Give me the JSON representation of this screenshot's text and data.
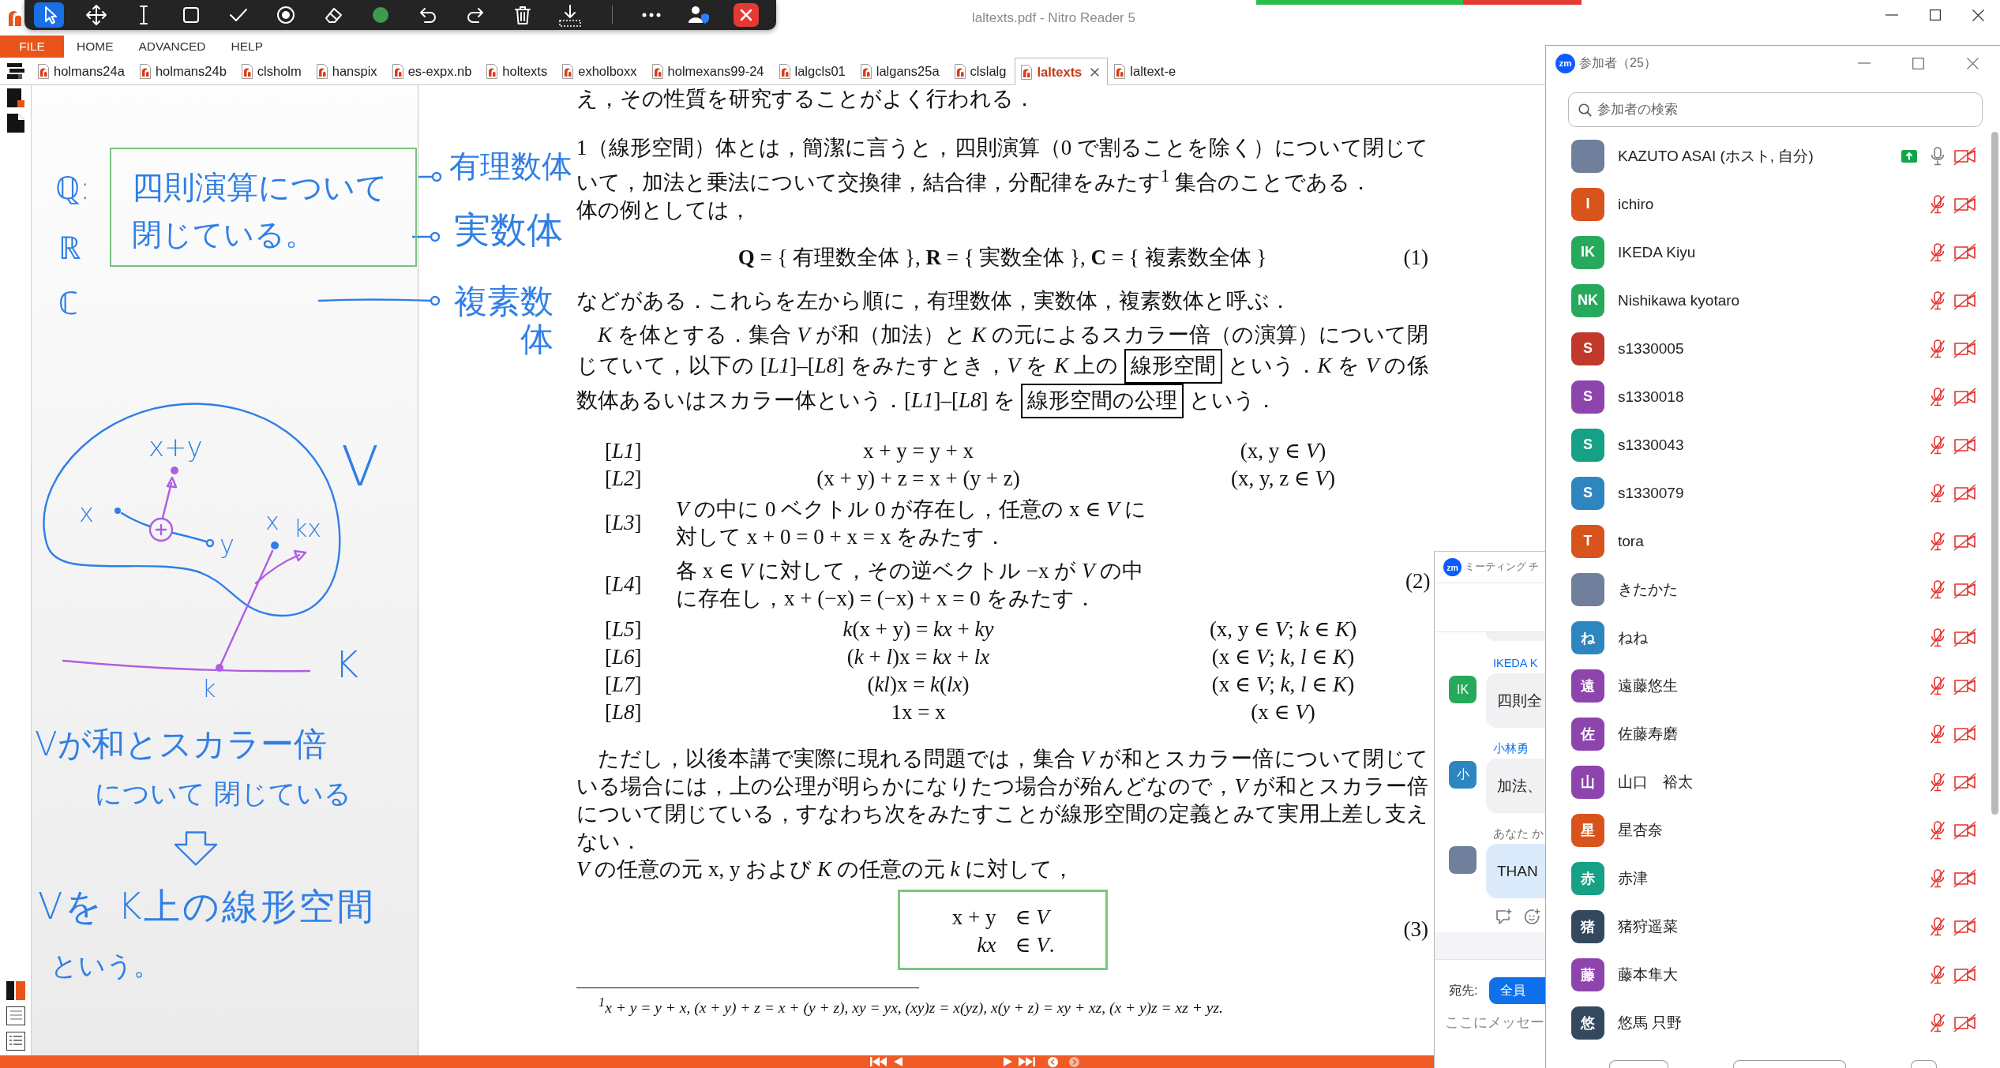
{
  "window": {
    "title": "laltexts.pdf - Nitro Reader 5"
  },
  "annotation_toolbar": {
    "tools": [
      {
        "kind": "pointer",
        "selected": true
      },
      {
        "kind": "move",
        "selected": false
      },
      {
        "kind": "text",
        "selected": false
      },
      {
        "kind": "rectangle",
        "selected": false
      },
      {
        "kind": "check",
        "selected": false
      },
      {
        "kind": "spotlight",
        "selected": false
      },
      {
        "kind": "eraser",
        "selected": false
      },
      {
        "kind": "color",
        "selected": false,
        "color": "#3e9a4c"
      },
      {
        "kind": "undo",
        "selected": false
      },
      {
        "kind": "redo",
        "selected": false
      },
      {
        "kind": "delete",
        "selected": false
      },
      {
        "kind": "save",
        "selected": false
      }
    ],
    "actions": [
      {
        "kind": "more"
      },
      {
        "kind": "people"
      },
      {
        "kind": "close"
      }
    ]
  },
  "menu": [
    {
      "label": "FILE",
      "kind": "file"
    },
    {
      "label": "HOME",
      "kind": "menu"
    },
    {
      "label": "ADVANCED",
      "kind": "menu"
    },
    {
      "label": "HELP",
      "kind": "menu"
    }
  ],
  "tabs": [
    {
      "label": "holmans24a",
      "selected": false
    },
    {
      "label": "holmans24b",
      "selected": false
    },
    {
      "label": "clsholm",
      "selected": false
    },
    {
      "label": "hanspix",
      "selected": false
    },
    {
      "label": "es-expx.nb",
      "selected": false
    },
    {
      "label": "holtexts",
      "selected": false
    },
    {
      "label": "exholboxx",
      "selected": false
    },
    {
      "label": "holmexans99-24",
      "selected": false
    },
    {
      "label": "lalgcls01",
      "selected": false
    },
    {
      "label": "lalgans25a",
      "selected": false
    },
    {
      "label": "clslalg",
      "selected": false
    },
    {
      "label": "laltexts",
      "selected": true
    },
    {
      "label": "laltext-e",
      "selected": false
    }
  ],
  "notes": {
    "axis_labels": [
      "ℚ:",
      "ℝ",
      "ℂ"
    ],
    "boxed_lines": [
      "四則演算について",
      "閉じている。"
    ],
    "callouts": [
      "有理数体",
      "実数体",
      "複素数体"
    ],
    "diagram_labels": [
      "x+y",
      "x",
      "y",
      "x",
      "kx",
      "V",
      "K",
      "k"
    ],
    "conclusion": [
      "Vが和とスカラー倍",
      "について 閉じている",
      "Vを K上の線形空間",
      "という。"
    ]
  },
  "document": {
    "top_line": "え，その性質を研究することがよく行われる．",
    "blocks": [
      {
        "kind": "paragraph",
        "parts": [
          {
            "kind": "plain",
            "text": "1（線形空間）体とは，簡潔に言うと，四則演算（0 で割ることを除く）について閉じていて，加法と乗法について交換律，結合律，分配律をみたす$^{1}$ 集合のことである．"
          }
        ]
      },
      {
        "kind": "paragraph",
        "parts": [
          {
            "kind": "plain",
            "text": "体の例としては，"
          }
        ]
      },
      {
        "kind": "equation",
        "text": "**Q** = { 有理数全体 }, **R** = { 実数全体 }, **C** = { 複素数全体 }",
        "number": "(1)"
      },
      {
        "kind": "paragraph",
        "parts": [
          {
            "kind": "plain",
            "text": "などがある．これらを左から順に，有理数体，実数体，複素数体と呼ぶ．"
          }
        ]
      },
      {
        "kind": "indented",
        "parts": [
          {
            "kind": "plain",
            "text": "*K* を体とする．集合 *V* が和（加法）と *K* の元によるスカラー倍（の演算）について閉じていて，以下の [*L1*]–[*L8*] をみたすとき，*V* を *K* 上の "
          },
          {
            "kind": "boxed",
            "text": "線形空間"
          },
          {
            "kind": "plain",
            "text": " という．*K* を *V* の係数体あるいはスカラー体という．[*L1*]–[*L8*] を "
          },
          {
            "kind": "boxed",
            "text": "線形空間の公理"
          },
          {
            "kind": "plain",
            "text": " という．"
          }
        ]
      },
      {
        "kind": "axioms",
        "number": "(2)",
        "rows": [
          {
            "label": "[*L1*]",
            "kind": "formula",
            "formula": "x + y = y + x",
            "condition": "(x, y ∈ *V*)"
          },
          {
            "label": "[*L2*]",
            "kind": "formula",
            "formula": "(x + y) + z = x + (y + z)",
            "condition": "(x, y, z ∈ *V*)"
          },
          {
            "label": "[*L3*]",
            "kind": "statement",
            "text": "*V* の中に 0 ベクトル 0 が存在し，任意の x ∈ *V* に対して x + 0 = 0 + x = x をみたす．"
          },
          {
            "label": "[*L4*]",
            "kind": "statement",
            "text": "各 x ∈ *V* に対して，その逆ベクトル −x が *V* の中に存在し，x + (−x) = (−x) + x = 0 をみたす．"
          },
          {
            "label": "[*L5*]",
            "kind": "formula",
            "formula": "*k*(x + y) = *kx* + *ky*",
            "condition": "(x, y ∈ *V*; *k* ∈ *K*)"
          },
          {
            "label": "[*L6*]",
            "kind": "formula",
            "formula": "(*k* + *l*)x = *kx* + *lx*",
            "condition": "(x ∈ *V*; *k*, *l* ∈ *K*)"
          },
          {
            "label": "[*L7*]",
            "kind": "formula",
            "formula": "(*kl*)x = *k*(*lx*)",
            "condition": "(x ∈ *V*; *k*, *l* ∈ *K*)"
          },
          {
            "label": "[*L8*]",
            "kind": "formula",
            "formula": "1x = x",
            "condition": "(x ∈ *V*)"
          }
        ]
      },
      {
        "kind": "indented",
        "parts": [
          {
            "kind": "plain",
            "text": "ただし，以後本講で実際に現れる問題では，集合 *V* が和とスカラー倍について閉じている場合には，上の公理が明らかになりたつ場合が殆んどなので，*V* が和とスカラー倍について閉じている，すなわち次をみたすことが線形空間の定義とみて実用上差し支えない．"
          }
        ]
      },
      {
        "kind": "paragraph",
        "parts": [
          {
            "kind": "plain",
            "text": "*V* の任意の元 x, y および *K* の任意の元 *k* に対して，"
          }
        ]
      },
      {
        "kind": "boxed_equation",
        "number": "(3)",
        "lines": [
          {
            "lhs": "x + y",
            "rhs": "∈ *V*"
          },
          {
            "lhs": "*kx*",
            "rhs": "∈ *V*."
          }
        ]
      }
    ],
    "footnote": "$^{1}$x + y = y + x, (x + y) + z = x + (y + z), xy = yx, (xy)z = x(yz), x(y + z) = xy + xz, (x + y)z = xz + yz."
  },
  "participants": {
    "badge": "zm",
    "title": "参加者（25）",
    "search": {
      "placeholder": "参加者の検索"
    },
    "rows": [
      {
        "name": "KAZUTO ASAI (ホスト, 自分)",
        "avatar": {
          "kind": "photo"
        },
        "sharing": true,
        "mic_muted": false,
        "video_off": true
      },
      {
        "name": "ichiro",
        "avatar": {
          "kind": "initial",
          "text": "I",
          "color": "#d8541c"
        },
        "sharing": false,
        "mic_muted": true,
        "video_off": true
      },
      {
        "name": "IKEDA Kiyu",
        "avatar": {
          "kind": "initial",
          "text": "IK",
          "color": "#27a95b"
        },
        "sharing": false,
        "mic_muted": true,
        "video_off": true
      },
      {
        "name": "Nishikawa kyotaro",
        "avatar": {
          "kind": "initial",
          "text": "NK",
          "color": "#27a95b"
        },
        "sharing": false,
        "mic_muted": true,
        "video_off": true
      },
      {
        "name": "s1330005",
        "avatar": {
          "kind": "initial",
          "text": "S",
          "color": "#c0392b"
        },
        "sharing": false,
        "mic_muted": true,
        "video_off": true
      },
      {
        "name": "s1330018",
        "avatar": {
          "kind": "initial",
          "text": "S",
          "color": "#8e44ad"
        },
        "sharing": false,
        "mic_muted": true,
        "video_off": true
      },
      {
        "name": "s1330043",
        "avatar": {
          "kind": "initial",
          "text": "S",
          "color": "#16a085"
        },
        "sharing": false,
        "mic_muted": true,
        "video_off": true
      },
      {
        "name": "s1330079",
        "avatar": {
          "kind": "initial",
          "text": "S",
          "color": "#2e86c1"
        },
        "sharing": false,
        "mic_muted": true,
        "video_off": true
      },
      {
        "name": "tora",
        "avatar": {
          "kind": "initial",
          "text": "T",
          "color": "#d8541c"
        },
        "sharing": false,
        "mic_muted": true,
        "video_off": true
      },
      {
        "name": "きたかた",
        "avatar": {
          "kind": "photo"
        },
        "sharing": false,
        "mic_muted": true,
        "video_off": true
      },
      {
        "name": "ねね",
        "avatar": {
          "kind": "initial",
          "text": "ね",
          "color": "#2e86c1"
        },
        "sharing": false,
        "mic_muted": true,
        "video_off": true
      },
      {
        "name": "遠藤悠生",
        "avatar": {
          "kind": "initial",
          "text": "遠",
          "color": "#8e44ad"
        },
        "sharing": false,
        "mic_muted": true,
        "video_off": true
      },
      {
        "name": "佐藤寿磨",
        "avatar": {
          "kind": "initial",
          "text": "佐",
          "color": "#8e44ad"
        },
        "sharing": false,
        "mic_muted": true,
        "video_off": true
      },
      {
        "name": "山口　裕太",
        "avatar": {
          "kind": "initial",
          "text": "山",
          "color": "#8e44ad"
        },
        "sharing": false,
        "mic_muted": true,
        "video_off": true
      },
      {
        "name": "星杏奈",
        "avatar": {
          "kind": "initial",
          "text": "星",
          "color": "#d8541c"
        },
        "sharing": false,
        "mic_muted": true,
        "video_off": true
      },
      {
        "name": "赤津",
        "avatar": {
          "kind": "initial",
          "text": "赤",
          "color": "#16a085"
        },
        "sharing": false,
        "mic_muted": true,
        "video_off": true
      },
      {
        "name": "猪狩遥菜",
        "avatar": {
          "kind": "initial",
          "text": "猪",
          "color": "#34495e"
        },
        "sharing": false,
        "mic_muted": true,
        "video_off": true
      },
      {
        "name": "藤本隼大",
        "avatar": {
          "kind": "initial",
          "text": "藤",
          "color": "#8e44ad"
        },
        "sharing": false,
        "mic_muted": true,
        "video_off": true
      },
      {
        "name": "悠馬 只野",
        "avatar": {
          "kind": "initial",
          "text": "悠",
          "color": "#34495e"
        },
        "sharing": false,
        "mic_muted": true,
        "video_off": true
      }
    ]
  },
  "chat": {
    "badge": "zm",
    "title": "ミーティング チ",
    "messages": [
      {
        "sender": "IKEDA K",
        "avatar": {
          "kind": "initial",
          "text": "IK",
          "color": "#27a95b"
        },
        "text": "四則全",
        "mine": false
      },
      {
        "sender": "小林勇",
        "avatar": {
          "kind": "initial",
          "text": "小",
          "color": "#2e86c1"
        },
        "text": "加法、",
        "mine": false
      },
      {
        "sender": "あなた か",
        "avatar": {
          "kind": "photo"
        },
        "text": "THAN",
        "mine": true
      }
    ],
    "recipient_label": "宛先:",
    "recipient": "全員",
    "input": {
      "placeholder": "ここにメッセー"
    }
  }
}
